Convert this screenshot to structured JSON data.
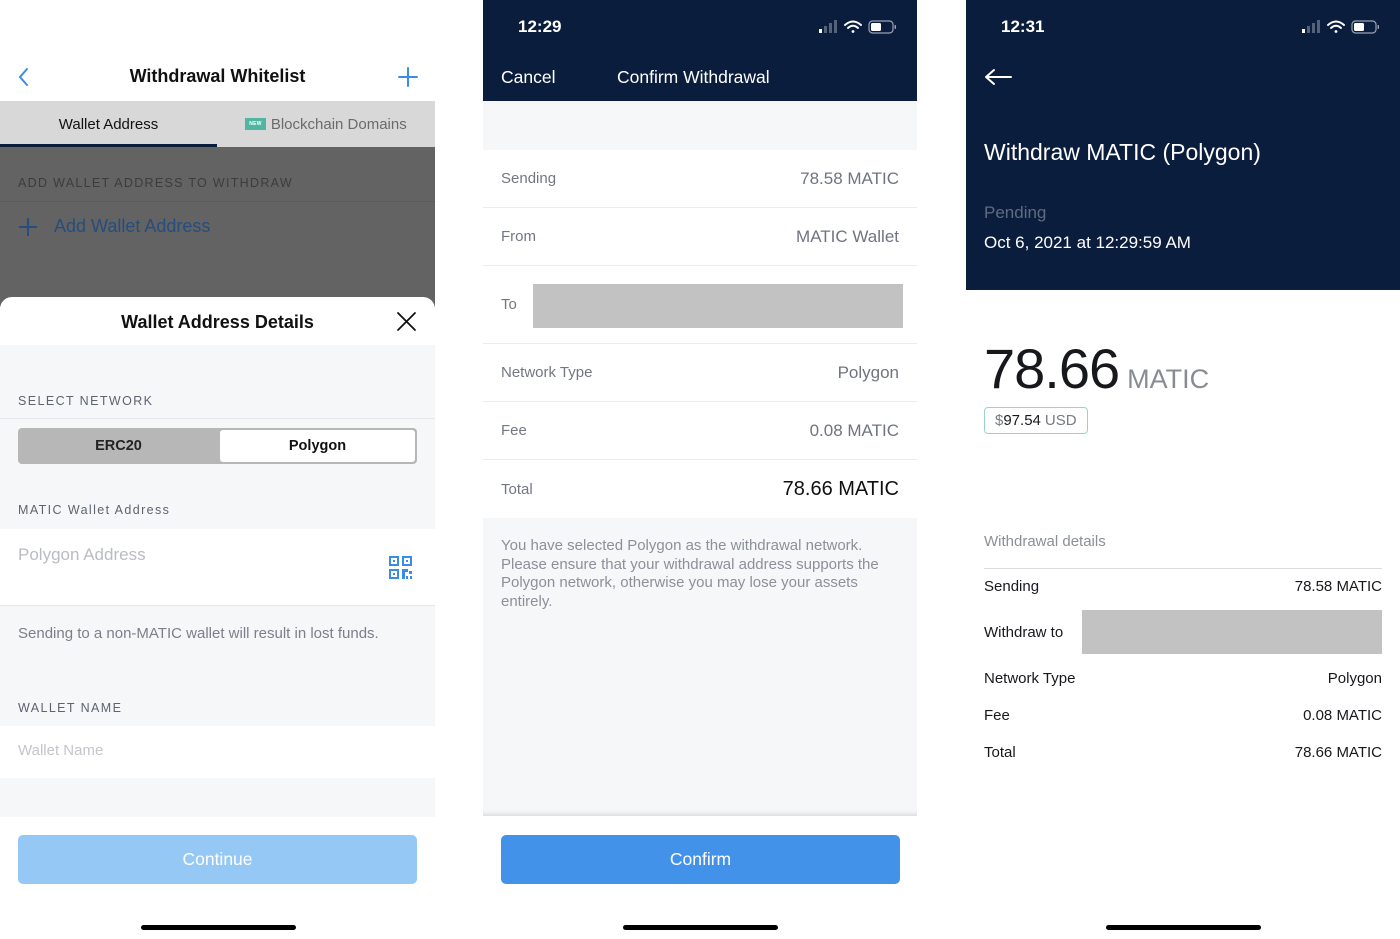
{
  "panel1": {
    "nav": {
      "title": "Withdrawal Whitelist",
      "back_icon": "chevron-left-icon",
      "add_icon": "plus-icon"
    },
    "tabs": [
      {
        "label": "Wallet Address",
        "active": true
      },
      {
        "label": "Blockchain Domains",
        "badge": "NEW",
        "active": false
      }
    ],
    "background": {
      "section_label": "ADD WALLET ADDRESS TO WITHDRAW",
      "add_label": "Add Wallet Address"
    },
    "sheet": {
      "title": "Wallet Address Details",
      "select_network_label": "SELECT NETWORK",
      "network_options": [
        "ERC20",
        "Polygon"
      ],
      "selected_network": "Polygon",
      "address_label": "MATIC Wallet Address",
      "address_placeholder": "Polygon Address",
      "address_value": "",
      "warning": "Sending to a non-MATIC wallet will result in lost funds.",
      "wallet_name_label": "WALLET NAME",
      "wallet_name_placeholder": "Wallet Name",
      "wallet_name_value": "",
      "continue_label": "Continue"
    }
  },
  "panel2": {
    "status_time": "12:29",
    "cancel_label": "Cancel",
    "title": "Confirm Withdrawal",
    "rows": [
      {
        "label": "Sending",
        "value": "78.58 MATIC"
      },
      {
        "label": "From",
        "value": "MATIC Wallet"
      },
      {
        "label": "To",
        "value": "[redacted]"
      },
      {
        "label": "Network Type",
        "value": "Polygon"
      },
      {
        "label": "Fee",
        "value": "0.08 MATIC"
      },
      {
        "label": "Total",
        "value": "78.66 MATIC"
      }
    ],
    "note": "You have selected Polygon as the withdrawal network. Please ensure that your withdrawal address supports the Polygon network, otherwise you may lose your assets entirely.",
    "confirm_label": "Confirm"
  },
  "panel3": {
    "status_time": "12:31",
    "title": "Withdraw MATIC (Polygon)",
    "status": "Pending",
    "date": "Oct 6, 2021 at 12:29:59 AM",
    "amount": "78.66",
    "amount_unit": "MATIC",
    "usd": {
      "symbol": "$",
      "value": "97.54",
      "currency": "USD"
    },
    "details_label": "Withdrawal details",
    "rows": [
      {
        "label": "Sending",
        "value": "78.58 MATIC"
      },
      {
        "label": "Withdraw to",
        "value": "[redacted]"
      },
      {
        "label": "Network Type",
        "value": "Polygon"
      },
      {
        "label": "Fee",
        "value": "0.08 MATIC"
      },
      {
        "label": "Total",
        "value": "78.66 MATIC"
      }
    ]
  },
  "colors": {
    "navy_header": "#0b1d3d",
    "primary_blue": "#4392ea",
    "disabled_blue": "#95c8f5",
    "new_badge": "#4fb7a1",
    "redaction": "#c2c2c2"
  }
}
